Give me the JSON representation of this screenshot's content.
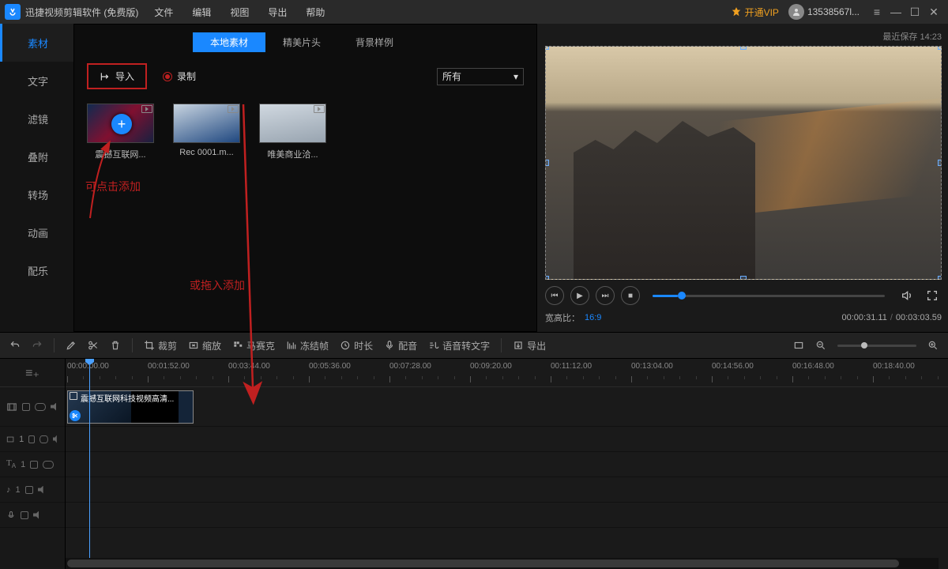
{
  "titlebar": {
    "app": "迅捷视频剪辑软件 (免费版)",
    "menus": [
      "文件",
      "编辑",
      "视图",
      "导出",
      "帮助"
    ],
    "vip": "开通VIP",
    "user": "13538567l...",
    "savetime": "最近保存 14:23"
  },
  "sidetabs": [
    "素材",
    "文字",
    "滤镜",
    "叠附",
    "转场",
    "动画",
    "配乐"
  ],
  "media": {
    "tabs": [
      "本地素材",
      "精美片头",
      "背景样例"
    ],
    "import": "导入",
    "record": "录制",
    "filter": "所有",
    "items": [
      "震撼互联网...",
      "Rec 0001.m...",
      "唯美商业洽..."
    ],
    "ann1": "可点击添加",
    "ann2": "或拖入添加"
  },
  "preview": {
    "aspect_label": "宽高比：",
    "aspect_value": "16:9",
    "cur": "00:00:31.11",
    "dur": "00:03:03.59"
  },
  "toolbar": {
    "crop": "裁剪",
    "zoom": "缩放",
    "mosaic": "马赛克",
    "freeze": "冻结帧",
    "duration": "时长",
    "dub": "配音",
    "stt": "语音转文字",
    "export": "导出"
  },
  "timeline": {
    "marks": [
      "00:00:00.00",
      "00:01:52.00",
      "00:03:44.00",
      "00:05:36.00",
      "00:07:28.00",
      "00:09:20.00",
      "00:11:12.00",
      "00:13:04.00",
      "00:14:56.00",
      "00:16:48.00",
      "00:18:40.00"
    ],
    "clip": "震撼互联网科技视频高清..."
  }
}
